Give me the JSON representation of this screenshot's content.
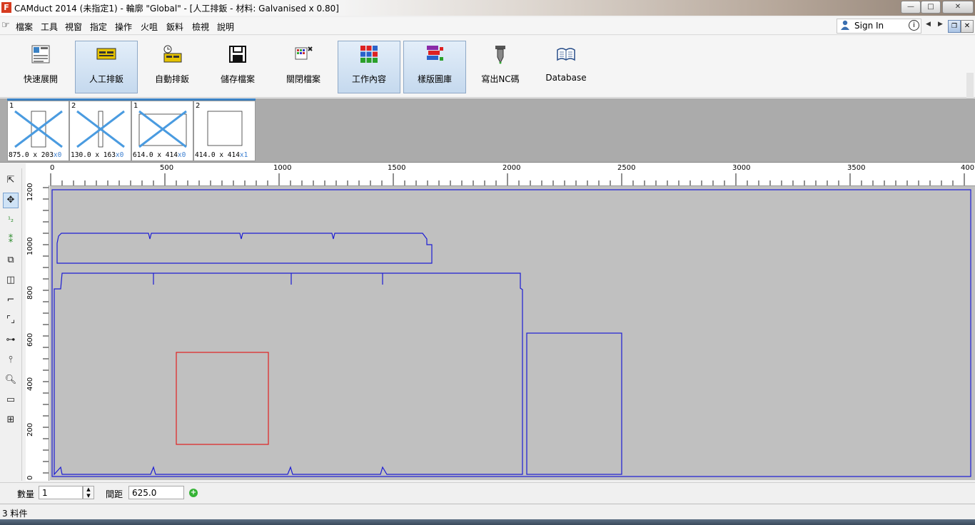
{
  "window": {
    "app_icon_letter": "F",
    "title": "CAMduct 2014 (未指定1) - 輪廓 \"Global\" - [人工排鈑  - 材料: Galvanised x 0.80]",
    "controls": {
      "minimize": "—",
      "maximize": "□",
      "close": "✕"
    }
  },
  "menu": {
    "items": [
      "檔案",
      "工具",
      "視窗",
      "指定",
      "操作",
      "火咀",
      "鈑料",
      "檢視",
      "說明"
    ],
    "sign_in": "Sign In"
  },
  "toolbar": {
    "buttons": [
      {
        "label": "快速展開",
        "icon": "quick-unfold-icon",
        "active": false
      },
      {
        "label": "人工排鈑",
        "icon": "manual-nesting-icon",
        "active": true
      },
      {
        "label": "自動排鈑",
        "icon": "auto-nesting-icon",
        "active": false
      },
      {
        "label": "儲存檔案",
        "icon": "save-icon",
        "active": false
      },
      {
        "label": "關閉檔案",
        "icon": "close-file-icon",
        "active": false
      },
      {
        "label": "工作內容",
        "icon": "job-contents-icon",
        "active": true
      },
      {
        "label": "樣版圖庫",
        "icon": "pattern-library-icon",
        "active": true
      },
      {
        "label": "寫出NC碼",
        "icon": "write-nc-icon",
        "active": false
      },
      {
        "label": "Database",
        "icon": "database-icon",
        "active": false
      }
    ]
  },
  "parts": [
    {
      "count": "1",
      "dims": "875.0 x 203",
      "qty": "x0",
      "crossed": true
    },
    {
      "count": "2",
      "dims": "130.0 x 163",
      "qty": "x0",
      "crossed": true
    },
    {
      "count": "1",
      "dims": "614.0 x 414",
      "qty": "x0",
      "crossed": true
    },
    {
      "count": "2",
      "dims": "414.0 x 414",
      "qty": "x1",
      "crossed": false
    }
  ],
  "ruler": {
    "x_labels": [
      "0",
      "500",
      "1000",
      "1500",
      "2000",
      "2500",
      "3000",
      "3500",
      "400"
    ],
    "y_labels": [
      "1200",
      "1000",
      "800",
      "600",
      "400",
      "200",
      "0"
    ]
  },
  "bottom": {
    "quantity_label": "數量",
    "quantity_value": "1",
    "gap_label": "間距",
    "gap_value": "625.0"
  },
  "status": {
    "text": "3 料件"
  }
}
